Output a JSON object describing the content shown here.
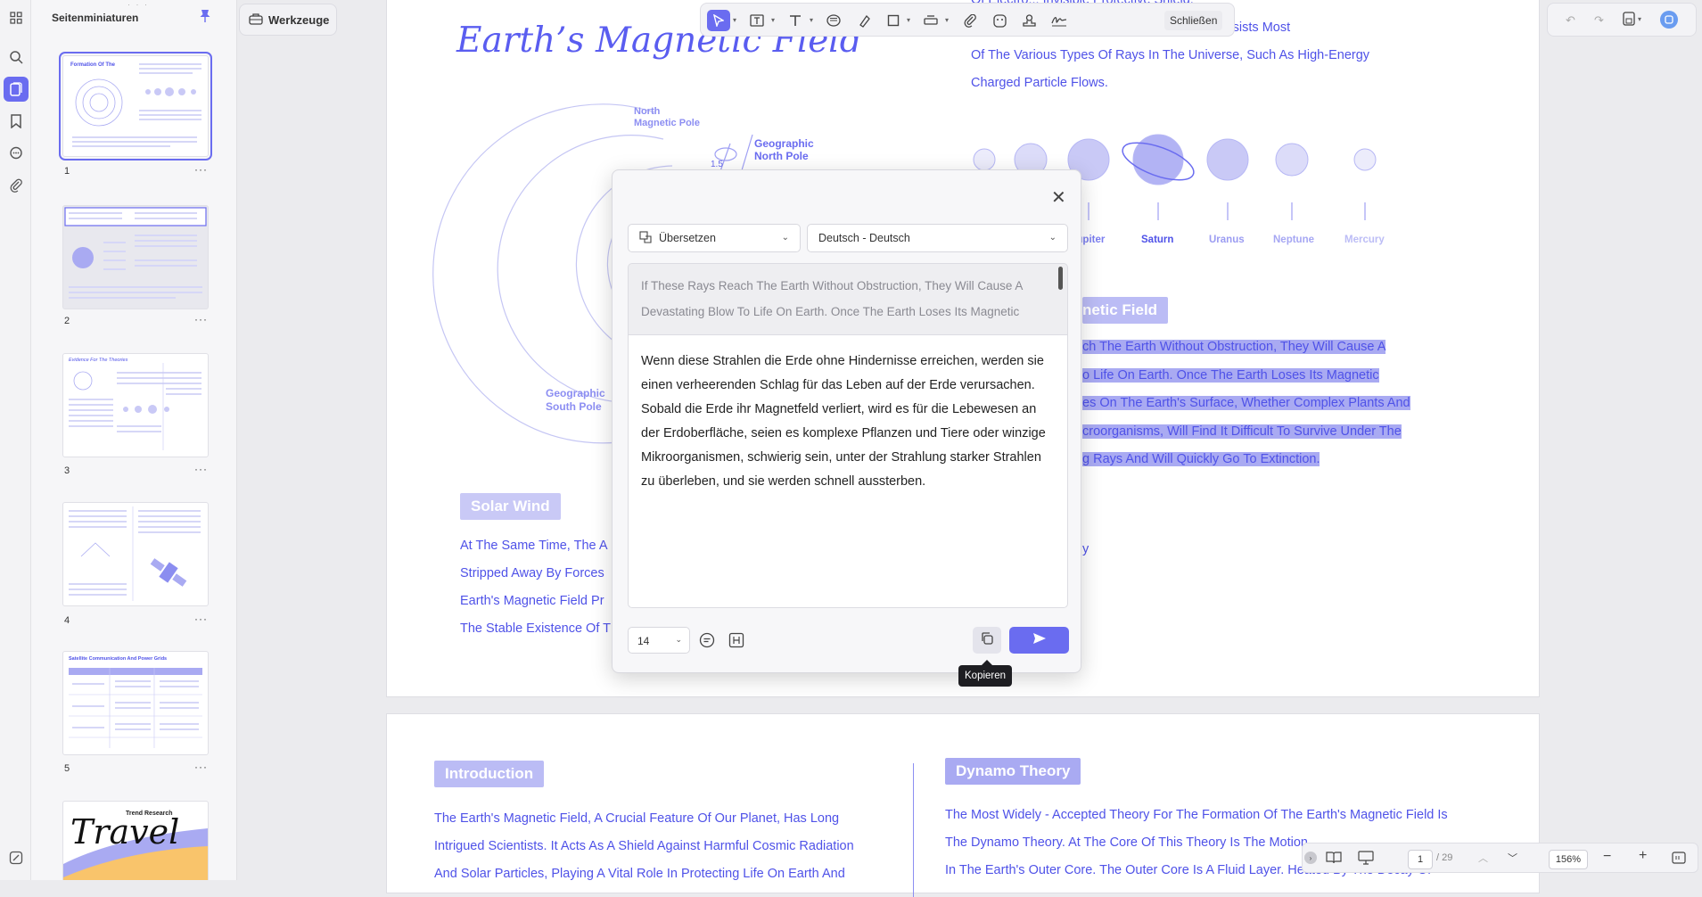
{
  "left_panel": {
    "title": "Seitenminiaturen"
  },
  "thumbnails": [
    {
      "number": "1",
      "title": "Formation Of The"
    },
    {
      "number": "2"
    },
    {
      "number": "3",
      "title": "Evidence For The Theories"
    },
    {
      "number": "4"
    },
    {
      "number": "5",
      "title": "Satellite Communication And Power Grids"
    },
    {
      "number": "",
      "title": "Travel",
      "subtitle": "Trend Research"
    }
  ],
  "toolbar": {
    "tools_label": "Werkzeuge",
    "close_label": "Schließen"
  },
  "page1": {
    "title": "Earth’s Magnetic Field",
    "top_right_lines": [
      "Of Electro... Invisible Protective Shield,",
      "ent. It Effectively Resists Most",
      "Of The Various Types Of Rays In The Universe, Such As High-Energy",
      "Charged Particle Flows."
    ],
    "diagram_labels": {
      "north_magnetic_pole": "North Magnetic Pole",
      "geographic_north_pole": "Geographic North Pole",
      "angle": "1.5",
      "geographic_south_pole": "Geographic South Pole"
    },
    "planets": [
      "Jupiter",
      "Saturn",
      "Uranus",
      "Neptune",
      "Mercury"
    ],
    "section_tag_right": "netic Field",
    "highlighted_lines": [
      "ch The Earth Without Obstruction, They Will Cause A",
      "o Life On Earth. Once The Earth Loses Its Magnetic",
      "es On The Earth's Surface, Whether Complex Plants And",
      "croorganisms, Will Find It Difficult To Survive Under The",
      "g Rays And Will Quickly Go To Extinction."
    ],
    "right_fragment": "y",
    "solar_wind_tag": "Solar Wind",
    "solar_wind_lines": [
      "At The Same Time, The A",
      "Stripped Away By Forces",
      "Earth's Magnetic Field Pr",
      "The Stable Existence Of T"
    ]
  },
  "page2": {
    "intro_tag": "Introduction",
    "intro_lines": [
      "The Earth's Magnetic Field, A Crucial Feature Of Our Planet, Has Long",
      "Intrigued Scientists. It Acts As A Shield Against Harmful Cosmic Radiation",
      "And Solar Particles, Playing A Vital Role In Protecting Life On Earth And"
    ],
    "dynamo_tag": "Dynamo Theory",
    "dynamo_lines": [
      "The Most Widely - Accepted Theory For The Formation Of The Earth's Magnetic Field Is",
      "The Dynamo Theory. At The Core Of This Theory Is The Motion",
      "In The Earth's Outer Core. The Outer Core Is A Fluid Layer. Heated By The Decay Of"
    ]
  },
  "dialog": {
    "mode": "Übersetzen",
    "language": "Deutsch - Deutsch",
    "source_text": "If These Rays Reach The Earth Without Obstruction, They Will Cause A Devastating Blow To Life On Earth. Once The Earth Loses Its Magnetic",
    "output_text": "Wenn diese Strahlen die Erde ohne Hindernisse erreichen, werden sie einen verheerenden Schlag für das Leben auf der Erde verursachen. Sobald die Erde ihr Magnetfeld verliert, wird es für die Lebewesen an der Erdoberfläche, seien es komplexe Pflanzen und Tiere oder winzige Mikroorganismen, schwierig sein, unter der Strahlung starker Strahlen zu überleben, und sie werden schnell aussterben.",
    "font_size": "14",
    "copy_tooltip": "Kopieren"
  },
  "status": {
    "page_current": "1",
    "page_total": "/ 29",
    "zoom": "156%"
  },
  "colors": {
    "accent": "#6a6cf0",
    "doc_blue": "#4f52e8",
    "tag_bg": "#c9c9f6"
  }
}
